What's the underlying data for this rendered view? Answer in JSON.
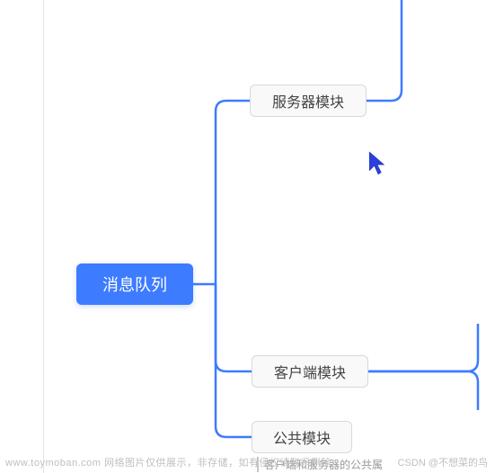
{
  "mindmap": {
    "root": {
      "label": "消息队列",
      "color": "#3d7bff"
    },
    "children": [
      {
        "id": "server",
        "label": "服务器模块"
      },
      {
        "id": "client",
        "label": "客户端模块"
      },
      {
        "id": "public",
        "label": "公共模块",
        "desc": "客户端和服务器的公共属"
      }
    ],
    "connector_color": "#3d7bff"
  },
  "watermark": {
    "left": "www.toymoban.com 网络图片仅供展示，非存储，如有侵权请联系删除。",
    "right": "CSDN @不想菜的鸟"
  }
}
